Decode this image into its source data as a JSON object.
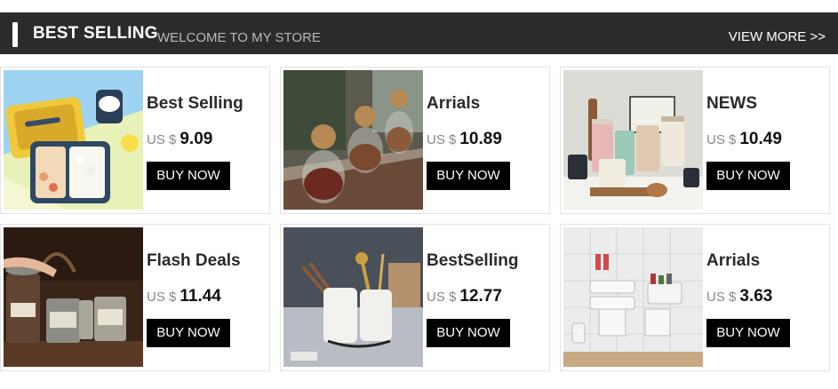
{
  "header": {
    "title": "BEST SELLING",
    "subtitle": "WELCOME TO MY STORE",
    "view_more": "VIEW MORE >>"
  },
  "products": [
    {
      "name": "Best Selling",
      "currency": "US $",
      "price": "9.09",
      "button": "BUY NOW",
      "image": "lunch-box-image"
    },
    {
      "name": "Arrials",
      "currency": "US $",
      "price": "10.89",
      "button": "BUY NOW",
      "image": "glass-jars-image"
    },
    {
      "name": "NEWS",
      "currency": "US $",
      "price": "10.49",
      "button": "BUY NOW",
      "image": "kitchen-canisters-image"
    },
    {
      "name": "Flash Deals",
      "currency": "US $",
      "price": "11.44",
      "button": "BUY NOW",
      "image": "tin-jars-image"
    },
    {
      "name": "BestSelling",
      "currency": "US $",
      "price": "12.77",
      "button": "BUY NOW",
      "image": "utensil-holder-image"
    },
    {
      "name": "Arrials",
      "currency": "US $",
      "price": "3.63",
      "button": "BUY NOW",
      "image": "paper-roll-holder-image"
    }
  ],
  "colors": {
    "header_bg": "#2b2b2b",
    "button_bg": "#000000",
    "text": "#222222"
  }
}
